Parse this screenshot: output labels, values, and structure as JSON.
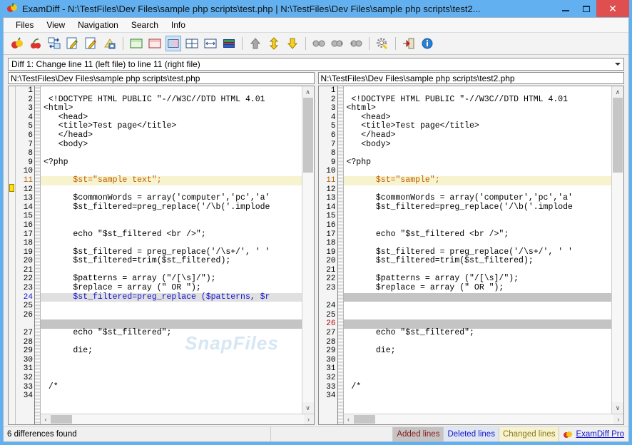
{
  "window": {
    "title": "ExamDiff - N:\\TestFiles\\Dev Files\\sample php scripts\\test.php  |  N:\\TestFiles\\Dev Files\\sample php scripts\\test2...",
    "app_icon": "apple-icon",
    "minimize_label": "–",
    "maximize_label": "□",
    "close_label": "✕",
    "titlebar_color": "#62b0ef",
    "close_color": "#e04f4f"
  },
  "menu": {
    "items": [
      {
        "label": "Files"
      },
      {
        "label": "View"
      },
      {
        "label": "Navigation"
      },
      {
        "label": "Search"
      },
      {
        "label": "Info"
      }
    ]
  },
  "toolbar": {
    "buttons": [
      {
        "name": "compare-files-icon",
        "title": "Compare Files"
      },
      {
        "name": "compare-directories-icon",
        "title": "Compare Directories"
      },
      {
        "name": "recompare-icon",
        "title": "Recompare"
      },
      {
        "name": "edit-left-file-icon",
        "title": "Edit Left File"
      },
      {
        "name": "edit-right-file-icon",
        "title": "Edit Right File"
      },
      {
        "name": "save-icon",
        "title": "Save"
      },
      {
        "name": "view-left-only-icon",
        "title": "View Left File Only"
      },
      {
        "name": "view-right-only-icon",
        "title": "View Right File Only"
      },
      {
        "name": "view-side-by-side-icon",
        "title": "Side by Side View",
        "selected": true
      },
      {
        "name": "view-grid-icon",
        "title": "Grid View"
      },
      {
        "name": "view-horizontal-split-icon",
        "title": "Horizontal Split"
      },
      {
        "name": "view-stacked-icon",
        "title": "Stacked View"
      },
      {
        "name": "previous-difference-icon",
        "title": "Previous Difference"
      },
      {
        "name": "next-difference-icon",
        "title": "Next Difference"
      },
      {
        "name": "down-arrow-icon",
        "title": "Go Down"
      },
      {
        "name": "find-icon",
        "title": "Find"
      },
      {
        "name": "find-next-icon",
        "title": "Find Next"
      },
      {
        "name": "find-previous-icon",
        "title": "Find Previous"
      },
      {
        "name": "options-gear-icon",
        "title": "Options"
      },
      {
        "name": "exit-icon",
        "title": "Exit"
      },
      {
        "name": "about-info-icon",
        "title": "About"
      }
    ]
  },
  "diff_select": {
    "value": "Diff 1: Change line 11 (left file) to line 11 (right file)",
    "chevron": "chevron-down-icon"
  },
  "left_pane": {
    "path": "N:\\TestFiles\\Dev Files\\sample php scripts\\test.php",
    "line_numbers": [
      "1",
      "2",
      "3",
      "4",
      "5",
      "6",
      "7",
      "8",
      "9",
      "10",
      "11",
      "12",
      "13",
      "14",
      "15",
      "16",
      "17",
      "18",
      "19",
      "20",
      "21",
      "22",
      "23",
      "24",
      "25",
      "26",
      "",
      "27",
      "28",
      "29",
      "30",
      "31",
      "32",
      "33",
      "34"
    ],
    "line_number_styles": [
      "",
      "",
      "",
      "",
      "",
      "",
      "",
      "",
      "",
      "",
      "orange",
      "",
      "",
      "",
      "",
      "",
      "",
      "",
      "",
      "",
      "",
      "",
      "",
      "blue",
      "",
      "",
      "empty",
      "",
      "",
      "",
      "",
      "",
      "",
      "",
      ""
    ],
    "lines": [
      {
        "text": "",
        "style": ""
      },
      {
        "text": " <!DOCTYPE HTML PUBLIC \"-//W3C//DTD HTML 4.01",
        "style": ""
      },
      {
        "text": "<html>",
        "style": ""
      },
      {
        "text": "   <head>",
        "style": ""
      },
      {
        "text": "   <title>Test page</title>",
        "style": ""
      },
      {
        "text": "   </head>",
        "style": ""
      },
      {
        "text": "   <body>",
        "style": ""
      },
      {
        "text": "",
        "style": ""
      },
      {
        "text": "<?php",
        "style": ""
      },
      {
        "text": "",
        "style": ""
      },
      {
        "text": "      $st=\"sample text\";",
        "style": "hl-change"
      },
      {
        "text": "",
        "style": ""
      },
      {
        "text": "      $commonWords = array('computer','pc','a'",
        "style": ""
      },
      {
        "text": "      $st_filtered=preg_replace('/\\b('.implode",
        "style": ""
      },
      {
        "text": "",
        "style": ""
      },
      {
        "text": "",
        "style": ""
      },
      {
        "text": "      echo \"$st_filtered <br />\";",
        "style": ""
      },
      {
        "text": "",
        "style": ""
      },
      {
        "text": "      $st_filtered = preg_replace('/\\s+/', ' '",
        "style": ""
      },
      {
        "text": "      $st_filtered=trim($st_filtered);",
        "style": ""
      },
      {
        "text": "",
        "style": ""
      },
      {
        "text": "      $patterns = array (\"/[\\s]/\");",
        "style": ""
      },
      {
        "text": "      $replace = array (\" OR \");",
        "style": ""
      },
      {
        "text": "      $st_filtered=preg_replace ($patterns, $r",
        "style": "hl-del"
      },
      {
        "text": "",
        "style": ""
      },
      {
        "text": "",
        "style": ""
      },
      {
        "text": "",
        "style": "hl-blank"
      },
      {
        "text": "      echo \"$st_filtered\";",
        "style": ""
      },
      {
        "text": "",
        "style": ""
      },
      {
        "text": "      die;",
        "style": ""
      },
      {
        "text": "",
        "style": ""
      },
      {
        "text": "",
        "style": ""
      },
      {
        "text": "",
        "style": ""
      },
      {
        "text": " /*",
        "style": ""
      },
      {
        "text": "",
        "style": ""
      }
    ]
  },
  "right_pane": {
    "path": "N:\\TestFiles\\Dev Files\\sample php scripts\\test2.php",
    "line_numbers": [
      "1",
      "2",
      "3",
      "4",
      "5",
      "6",
      "7",
      "8",
      "9",
      "10",
      "11",
      "12",
      "13",
      "14",
      "15",
      "16",
      "17",
      "18",
      "19",
      "20",
      "21",
      "22",
      "23",
      "",
      "24",
      "25",
      "26",
      "27",
      "28",
      "29",
      "30",
      "31",
      "32",
      "33",
      "34"
    ],
    "line_number_styles": [
      "",
      "",
      "",
      "",
      "",
      "",
      "",
      "",
      "",
      "",
      "orange",
      "",
      "",
      "",
      "",
      "",
      "",
      "",
      "",
      "",
      "",
      "",
      "",
      "empty",
      "",
      "",
      "red",
      "",
      "",
      "",
      "",
      "",
      "",
      "",
      ""
    ],
    "lines": [
      {
        "text": "",
        "style": ""
      },
      {
        "text": " <!DOCTYPE HTML PUBLIC \"-//W3C//DTD HTML 4.01",
        "style": ""
      },
      {
        "text": "<html>",
        "style": ""
      },
      {
        "text": "   <head>",
        "style": ""
      },
      {
        "text": "   <title>Test page</title>",
        "style": ""
      },
      {
        "text": "   </head>",
        "style": ""
      },
      {
        "text": "   <body>",
        "style": ""
      },
      {
        "text": "",
        "style": ""
      },
      {
        "text": "<?php",
        "style": ""
      },
      {
        "text": "",
        "style": ""
      },
      {
        "text": "      $st=\"sample\";",
        "style": "hl-change"
      },
      {
        "text": "",
        "style": ""
      },
      {
        "text": "      $commonWords = array('computer','pc','a'",
        "style": ""
      },
      {
        "text": "      $st_filtered=preg_replace('/\\b('.implode",
        "style": ""
      },
      {
        "text": "",
        "style": ""
      },
      {
        "text": "",
        "style": ""
      },
      {
        "text": "      echo \"$st_filtered <br />\";",
        "style": ""
      },
      {
        "text": "",
        "style": ""
      },
      {
        "text": "      $st_filtered = preg_replace('/\\s+/', ' '",
        "style": ""
      },
      {
        "text": "      $st_filtered=trim($st_filtered);",
        "style": ""
      },
      {
        "text": "",
        "style": ""
      },
      {
        "text": "      $patterns = array (\"/[\\s]/\");",
        "style": ""
      },
      {
        "text": "      $replace = array (\" OR \");",
        "style": ""
      },
      {
        "text": "",
        "style": "hl-add"
      },
      {
        "text": "",
        "style": ""
      },
      {
        "text": "",
        "style": ""
      },
      {
        "text": "",
        "style": "hl-blank"
      },
      {
        "text": "      echo \"$st_filtered\";",
        "style": ""
      },
      {
        "text": "",
        "style": ""
      },
      {
        "text": "      die;",
        "style": ""
      },
      {
        "text": "",
        "style": ""
      },
      {
        "text": "",
        "style": ""
      },
      {
        "text": "",
        "style": ""
      },
      {
        "text": " /*",
        "style": ""
      },
      {
        "text": "",
        "style": ""
      }
    ]
  },
  "watermark": {
    "text": "SnapFiles"
  },
  "statusbar": {
    "message": "6 differences found",
    "legend": [
      {
        "label": "Added lines",
        "kind": "added"
      },
      {
        "label": "Deleted lines",
        "kind": "deleted"
      },
      {
        "label": "Changed lines",
        "kind": "changed"
      }
    ],
    "link": {
      "label": "ExamDiff Pro",
      "icon": "apple-icon"
    }
  },
  "scrollbars": {
    "up_arrow": "∧",
    "down_arrow": "∨",
    "left_arrow": "‹",
    "right_arrow": "›"
  }
}
